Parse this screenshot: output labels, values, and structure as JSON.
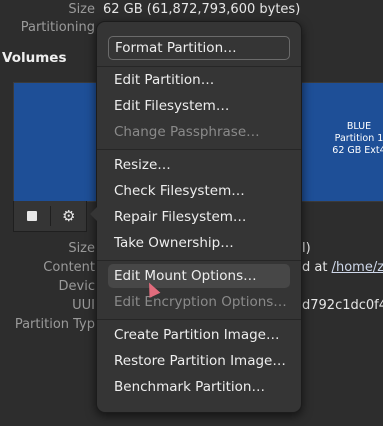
{
  "info": {
    "size_label": "Size",
    "size_value": "62 GB (61,872,793,600 bytes)",
    "partitioning_label": "Partitioning",
    "size2_label": "Size",
    "size2_value_tail": "l)",
    "contents_label": "Content",
    "contents_value_tail": "d at",
    "contents_link": "/home/ze",
    "device_label": "Devic",
    "uuid_label": "UUI",
    "uuid_value_tail": "d792c1dc0f4",
    "partition_type_label": "Partition Typ"
  },
  "volumes": {
    "title": "Volumes",
    "partition": {
      "name": "BLUE",
      "line2": "Partition 1",
      "line3": "62 GB Ext4",
      "color": "#1e4f97"
    },
    "toolbar": {
      "stop_icon": "stop-icon",
      "settings_icon": "gear-icon"
    }
  },
  "menu": {
    "items": [
      {
        "label": "Format Partition…",
        "disabled": false
      },
      {
        "label": "Edit Partition…",
        "disabled": false
      },
      {
        "label": "Edit Filesystem…",
        "disabled": false
      },
      {
        "label": "Change Passphrase…",
        "disabled": true
      },
      {
        "label": "Resize…",
        "disabled": false
      },
      {
        "label": "Check Filesystem…",
        "disabled": false
      },
      {
        "label": "Repair Filesystem…",
        "disabled": false
      },
      {
        "label": "Take Ownership…",
        "disabled": false
      },
      {
        "label": "Edit Mount Options…",
        "disabled": false
      },
      {
        "label": "Edit Encryption Options…",
        "disabled": true
      },
      {
        "label": "Create Partition Image…",
        "disabled": false
      },
      {
        "label": "Restore Partition Image…",
        "disabled": false
      },
      {
        "label": "Benchmark Partition…",
        "disabled": false
      }
    ]
  },
  "colors": {
    "background": "#2d2d2d",
    "popover": "#353535",
    "partition_selected": "#1e4f97"
  }
}
